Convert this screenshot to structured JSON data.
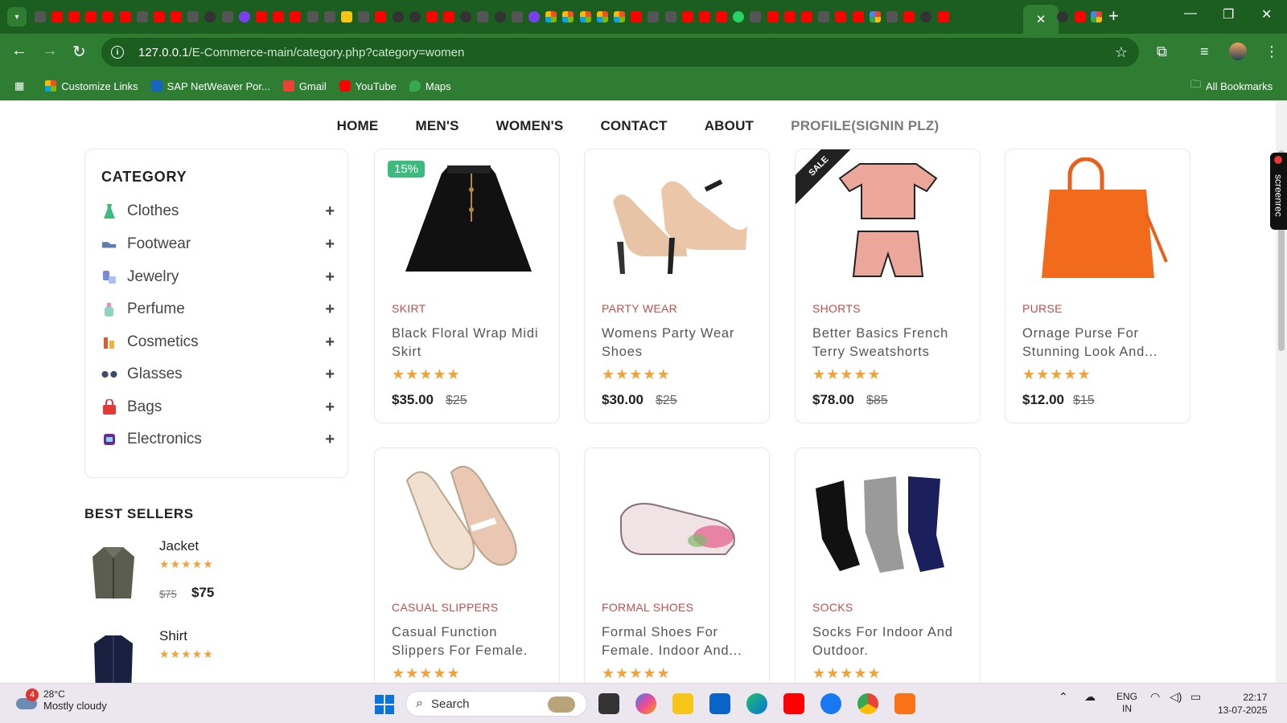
{
  "browser": {
    "active_tab_close": "✕",
    "new_tab": "+",
    "url_host": "127.0.0.1",
    "url_path": "/E-Commerce-main/category.php?category=women",
    "bookmarks": [
      {
        "label": "Customize Links"
      },
      {
        "label": "SAP NetWeaver Por..."
      },
      {
        "label": "Gmail"
      },
      {
        "label": "YouTube"
      },
      {
        "label": "Maps"
      }
    ],
    "all_bookmarks": "All Bookmarks"
  },
  "nav": {
    "home": "HOME",
    "mens": "MEN'S",
    "womens": "WOMEN'S",
    "contact": "CONTACT",
    "about": "ABOUT",
    "profile": "PROFILE(SIGNIN PLZ)"
  },
  "sidebar": {
    "title": "CATEGORY",
    "categories": [
      {
        "label": "Clothes",
        "icon": "dress-icon"
      },
      {
        "label": "Footwear",
        "icon": "shoe-icon"
      },
      {
        "label": "Jewelry",
        "icon": "jewelry-icon"
      },
      {
        "label": "Perfume",
        "icon": "perfume-icon"
      },
      {
        "label": "Cosmetics",
        "icon": "cosmetics-icon"
      },
      {
        "label": "Glasses",
        "icon": "glasses-icon"
      },
      {
        "label": "Bags",
        "icon": "bag-icon"
      },
      {
        "label": "Electronics",
        "icon": "watch-icon"
      }
    ],
    "plus": "+",
    "bestsellers_title": "BEST SELLERS",
    "bestsellers": [
      {
        "name": "Jacket",
        "stars": "★★★★★",
        "old_price": "$75",
        "price": "$75"
      },
      {
        "name": "Shirt",
        "stars": "★★★★★",
        "old_price": "",
        "price": ""
      }
    ]
  },
  "products": [
    {
      "category": "SKIRT",
      "title": "Black Floral Wrap Midi Skirt",
      "stars": "★★★★★",
      "price": "$35.00",
      "old_price": "$25",
      "badge": "15%"
    },
    {
      "category": "PARTY WEAR",
      "title": "Womens Party Wear Shoes",
      "stars": "★★★★★",
      "price": "$30.00",
      "old_price": "$25"
    },
    {
      "category": "SHORTS",
      "title": "Better Basics French Terry Sweatshorts",
      "stars": "★★★★★",
      "price": "$78.00",
      "old_price": "$85",
      "badge": "SALE"
    },
    {
      "category": "PURSE",
      "title": "Ornage Purse For Stunning Look And...",
      "stars": "★★★★★",
      "price": "$12.00",
      "old_price": "$15"
    },
    {
      "category": "CASUAL SLIPPERS",
      "title": "Casual Function Slippers For Female.",
      "stars": "★★★★★"
    },
    {
      "category": "FORMAL SHOES",
      "title": "Formal Shoes For Female. Indoor And...",
      "stars": "★★★★★"
    },
    {
      "category": "SOCKS",
      "title": "Socks For Indoor And Outdoor.",
      "stars": "★★★★★"
    }
  ],
  "screenrec": "screenrec",
  "taskbar": {
    "weather_badge": "4",
    "temp": "28°C",
    "weather_desc": "Mostly cloudy",
    "search": "Search",
    "lang1": "ENG",
    "lang2": "IN",
    "time": "22:17",
    "date": "13-07-2025"
  },
  "colors": {
    "chrome": "#2e7d32",
    "accent_category": "#c0504d",
    "stars": "#f0a33a",
    "badge": "#3dbb7e"
  }
}
